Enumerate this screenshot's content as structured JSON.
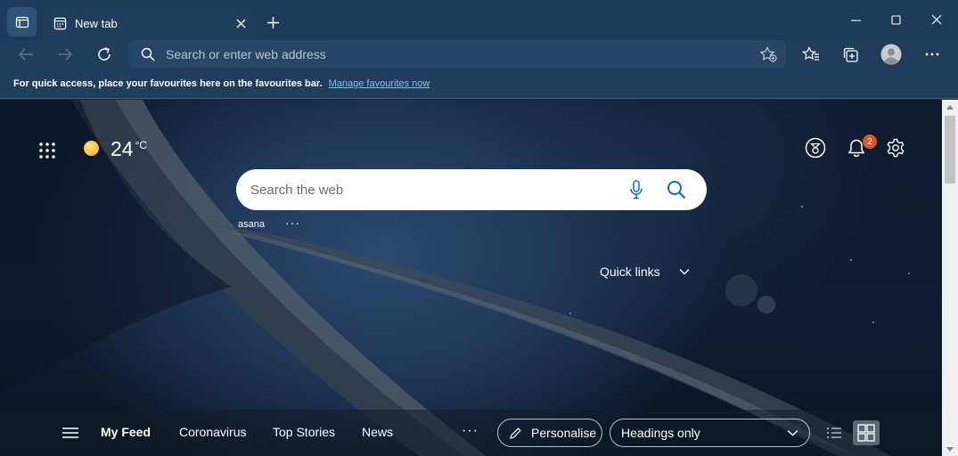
{
  "browser": {
    "tab": {
      "title": "New tab"
    },
    "address_bar": {
      "placeholder": "Search or enter web address"
    },
    "favourites_bar": {
      "message": "For quick access, place your favourites here on the favourites bar.",
      "link": "Manage favourites now"
    }
  },
  "new_tab_page": {
    "weather": {
      "temperature": "24",
      "unit": "°C"
    },
    "notifications": {
      "count": "2"
    },
    "search": {
      "placeholder": "Search the web"
    },
    "top_sites": [
      {
        "label": "asana"
      }
    ],
    "top_sites_more": "···",
    "quick_links": {
      "label": "Quick links"
    },
    "feed": {
      "tabs": [
        "My Feed",
        "Coronavirus",
        "Top Stories",
        "News"
      ],
      "more": "···",
      "personalise_label": "Personalise",
      "layout_select": {
        "value": "Headings only"
      }
    }
  },
  "colors": {
    "chrome_dark": "#1d3a5b",
    "chrome": "#223c5c",
    "link": "#7cc1f3",
    "badge": "#d6582a",
    "search_accent": "#0f6cbd"
  },
  "icons": [
    "tab-actions-icon",
    "newtab-page-icon",
    "close-icon",
    "plus-icon",
    "minimize-icon",
    "maximize-icon",
    "window-close-icon",
    "back-icon",
    "forward-icon",
    "refresh-icon",
    "search-icon",
    "add-favourite-icon",
    "favourites-icon",
    "collections-icon",
    "profile-icon",
    "more-icon",
    "apps-icon",
    "sun-icon",
    "rewards-icon",
    "bell-icon",
    "gear-icon",
    "microphone-icon",
    "chevron-down-icon",
    "hamburger-icon",
    "pencil-icon",
    "list-view-icon",
    "grid-view-icon"
  ]
}
